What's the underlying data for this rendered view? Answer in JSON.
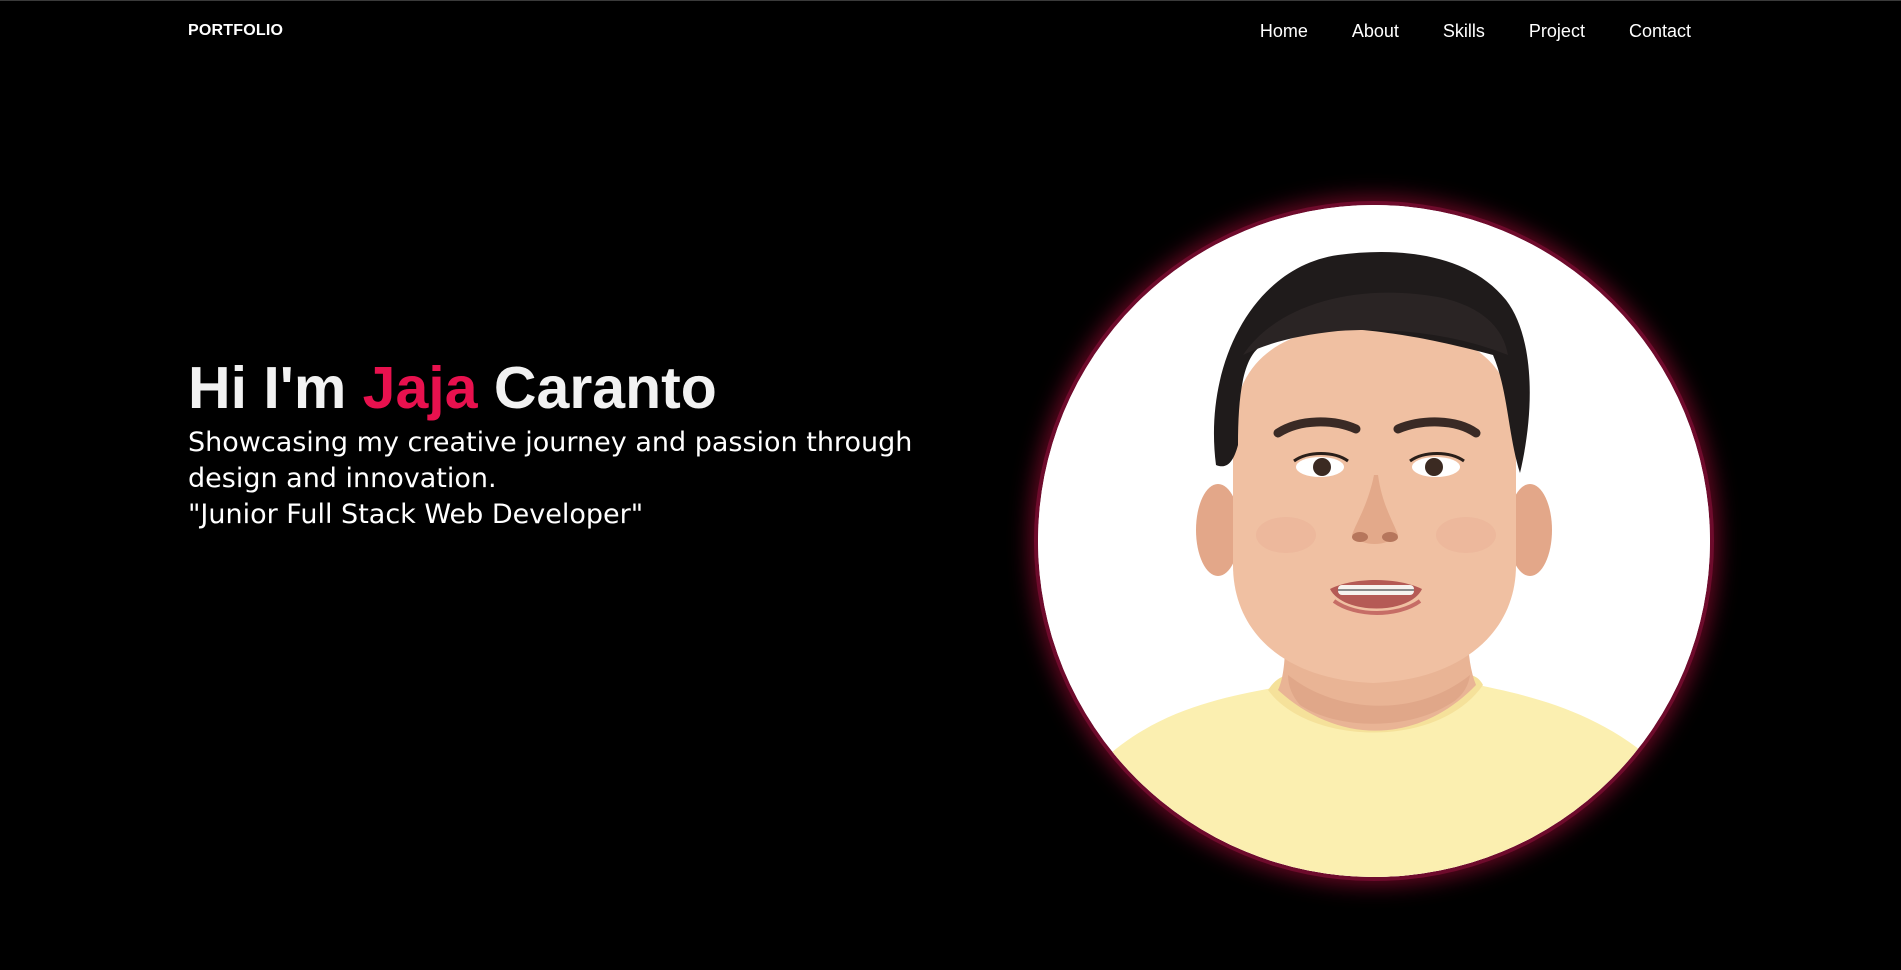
{
  "nav": {
    "logo": "PORTFOLIO",
    "links": [
      "Home",
      "About",
      "Skills",
      "Project",
      "Contact"
    ]
  },
  "hero": {
    "title_prefix": "Hi I'm ",
    "title_first_name": "Jaja",
    "title_last_name": " Caranto",
    "description": "Showcasing my creative journey and passion through design and innovation.",
    "role": "\"Junior Full Stack Web Developer\""
  },
  "colors": {
    "background": "#000000",
    "accent": "#e8114e",
    "text": "#ffffff"
  },
  "portrait": {
    "image": "profile-photo"
  }
}
